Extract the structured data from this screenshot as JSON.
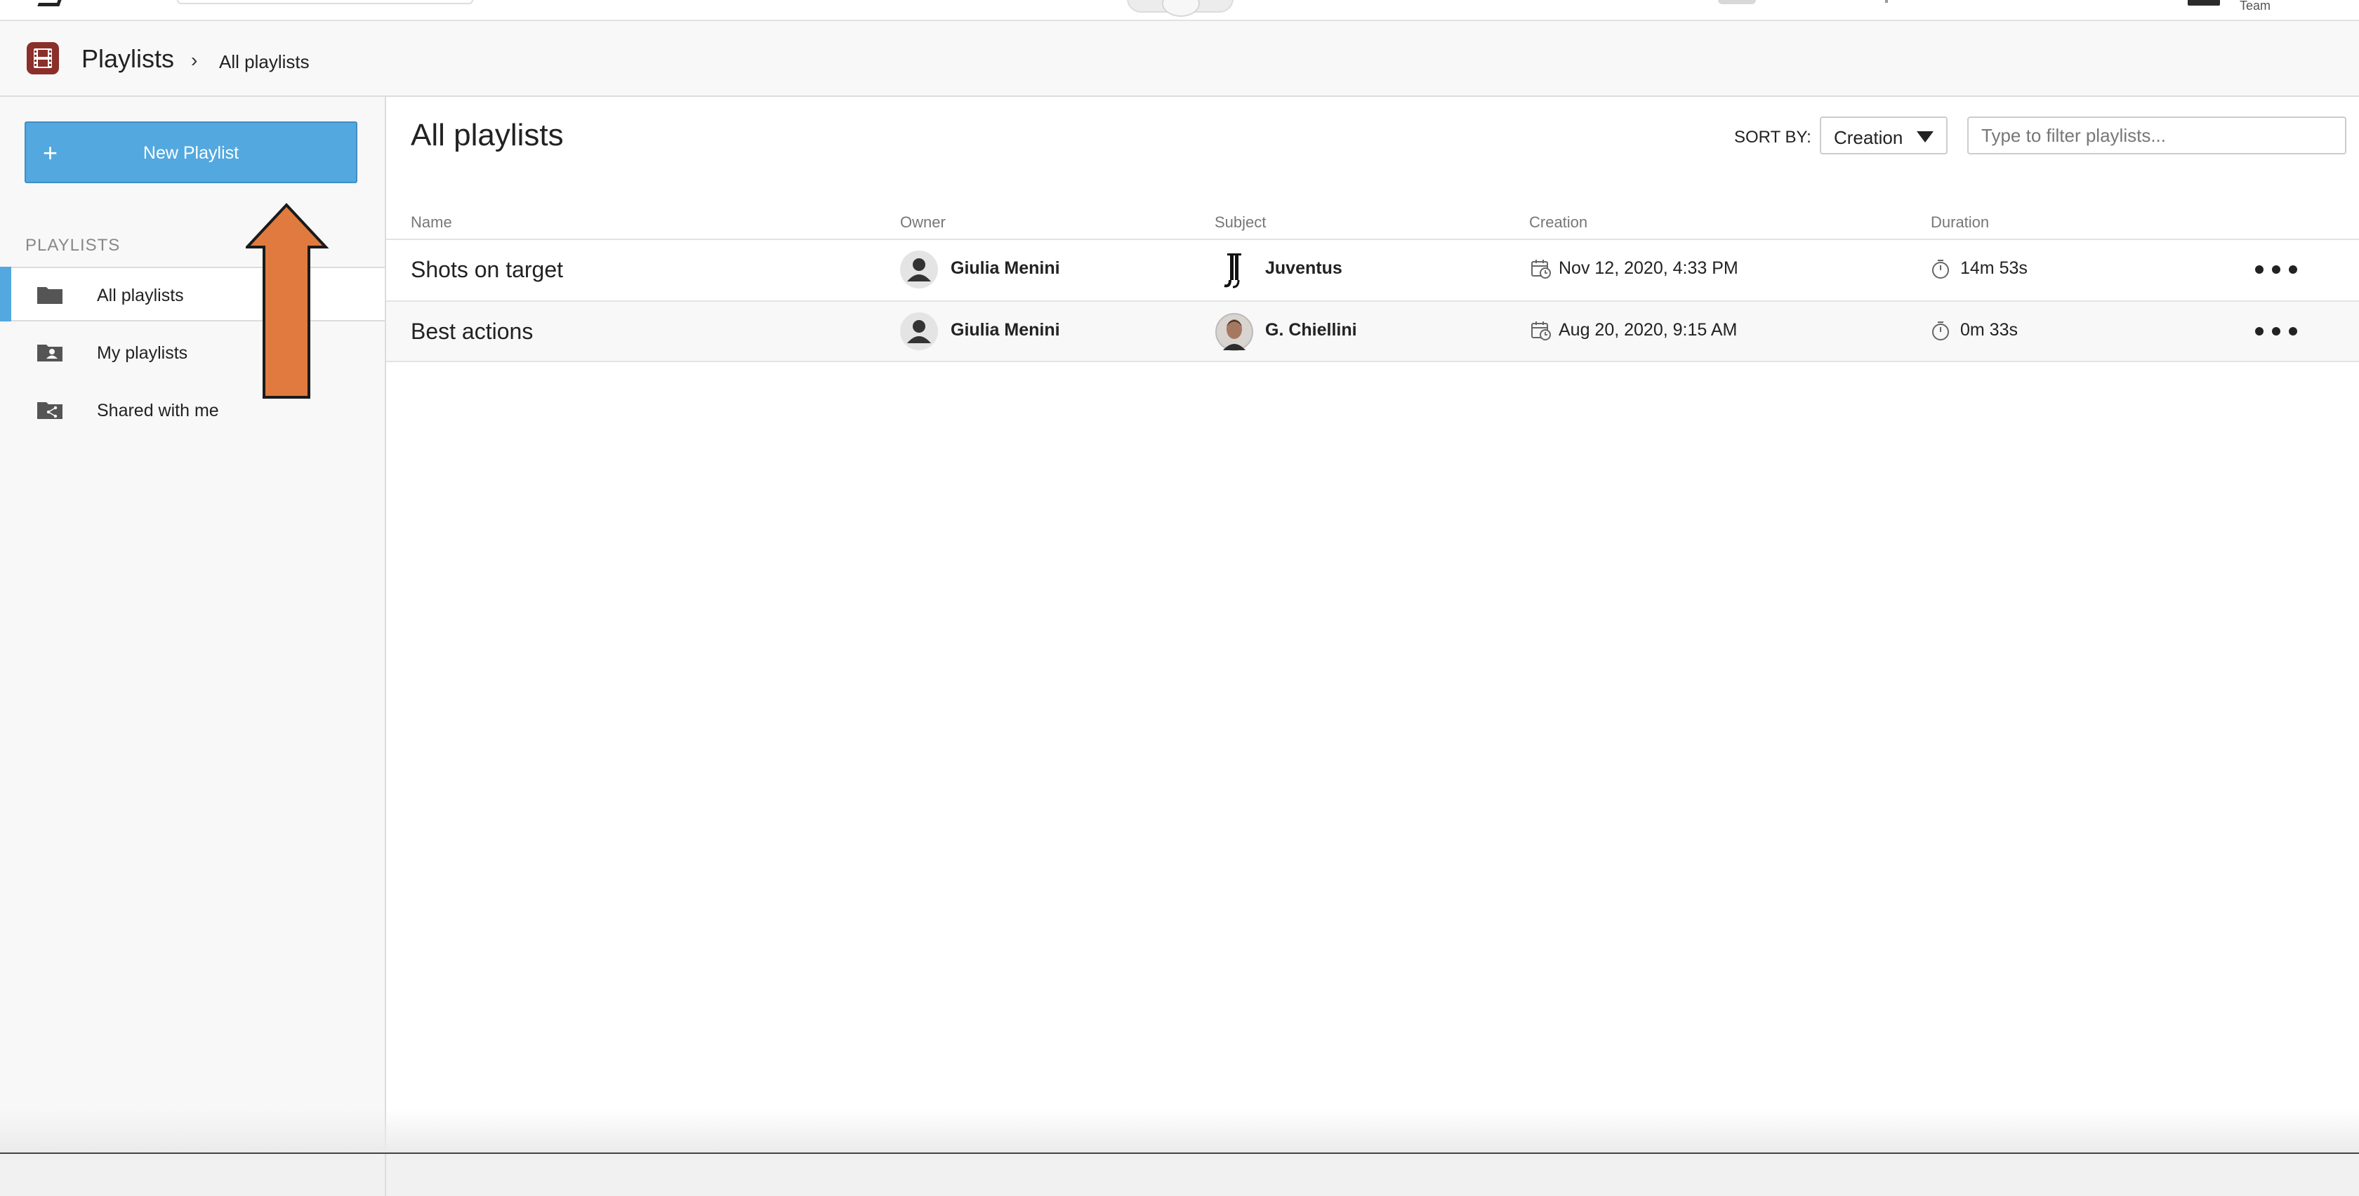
{
  "topbar": {
    "team_label": "Team"
  },
  "header": {
    "title": "Playlists",
    "separator": "›",
    "breadcrumb": "All playlists"
  },
  "sidebar": {
    "new_button_plus": "+",
    "new_button_label": "New Playlist",
    "section_label": "PLAYLISTS",
    "items": [
      {
        "label": "All playlists",
        "icon": "folder-icon",
        "active": true
      },
      {
        "label": "My playlists",
        "icon": "user-folder-icon",
        "active": false
      },
      {
        "label": "Shared with me",
        "icon": "shared-folder-icon",
        "active": false
      }
    ]
  },
  "main": {
    "heading": "All playlists",
    "sort_label": "SORT BY:",
    "sort_value": "Creation",
    "filter_placeholder": "Type to filter playlists...",
    "columns": [
      "Name",
      "Owner",
      "Subject",
      "Creation",
      "Duration"
    ],
    "rows": [
      {
        "name": "Shots on target",
        "owner": "Giulia Menini",
        "subject": "Juventus",
        "subject_icon": "juventus-logo-icon",
        "created": "Nov 12, 2020, 4:33 PM",
        "duration": "14m 53s"
      },
      {
        "name": "Best actions",
        "owner": "Giulia Menini",
        "subject": "G. Chiellini",
        "subject_icon": "player-photo-icon",
        "created": "Aug 20, 2020, 9:15 AM",
        "duration": "0m 33s"
      }
    ]
  },
  "colors": {
    "accent": "#53a8df",
    "app_icon": "#8b2f2a",
    "annotation_arrow": "#e07a3f"
  }
}
